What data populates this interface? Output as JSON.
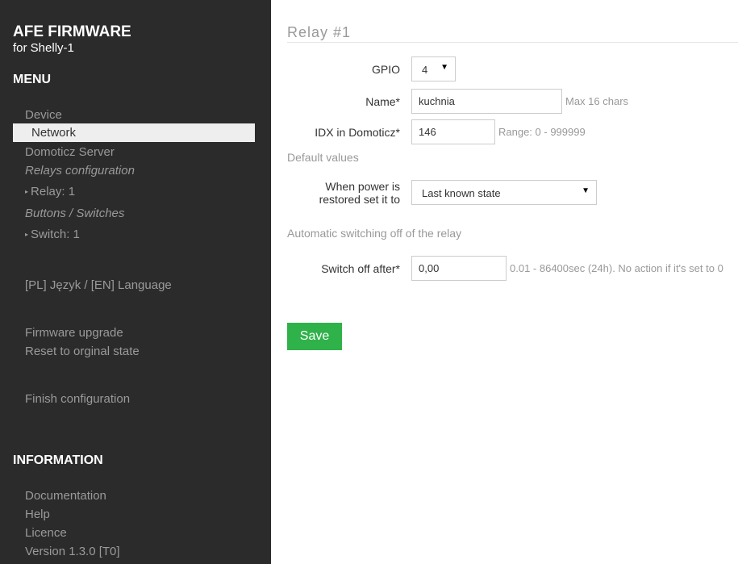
{
  "sidebar": {
    "brand_title": "AFE FIRMWARE",
    "brand_subtitle": "for Shelly-1",
    "menu_heading": "MENU",
    "items": {
      "device": "Device",
      "network": "Network",
      "domoticz_server": "Domoticz Server",
      "relays_configuration": "Relays configuration",
      "relay_1": "Relay: 1",
      "buttons_switches": "Buttons / Switches",
      "switch_1": "Switch: 1",
      "language": "[PL] Język / [EN] Language",
      "firmware_upgrade": "Firmware upgrade",
      "reset": "Reset to orginal state",
      "finish": "Finish configuration"
    },
    "info_heading": "INFORMATION",
    "info": {
      "documentation": "Documentation",
      "help": "Help",
      "licence": "Licence",
      "version": "Version 1.3.0 [T0]"
    },
    "arrow_glyph": "▸"
  },
  "main": {
    "title": "Relay #1",
    "gpio": {
      "label": "GPIO",
      "value": "4"
    },
    "name": {
      "label": "Name*",
      "value": "kuchnia",
      "hint": "Max 16 chars"
    },
    "idx": {
      "label": "IDX in Domoticz*",
      "value": "146",
      "hint": "Range: 0 - 999999"
    },
    "default_values_heading": "Default values",
    "power_restore": {
      "label_line1": "When power is",
      "label_line2": "restored set it to",
      "value": "Last known state"
    },
    "auto_switch_heading": "Automatic switching off of the relay",
    "switch_off": {
      "label": "Switch off after*",
      "value": "0,00",
      "hint": "0.01 - 86400sec (24h). No action if it's set to 0"
    },
    "save_label": "Save",
    "caret_glyph": "▼"
  },
  "colors": {
    "sidebar_bg": "#2b2b2b",
    "active_item_bg": "#eeeeee",
    "save_button": "#2fb24a"
  }
}
